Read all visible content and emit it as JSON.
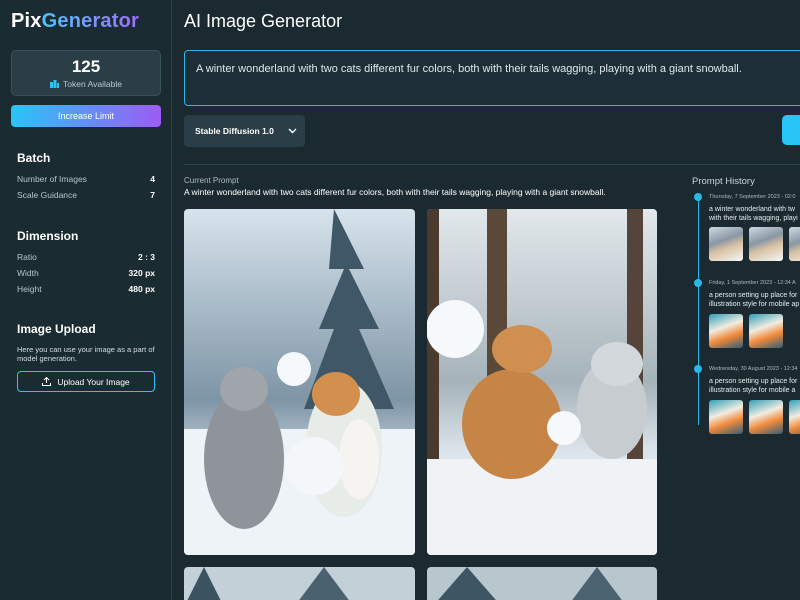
{
  "app": {
    "logo_part1": "Pix",
    "logo_part2": "Generator"
  },
  "tokens": {
    "count": "125",
    "label": "Token Available"
  },
  "increase_label": "Increase Limit",
  "batch": {
    "title": "Batch",
    "items": [
      {
        "label": "Number of Images",
        "value": "4"
      },
      {
        "label": "Scale Guidance",
        "value": "7"
      }
    ]
  },
  "dimension": {
    "title": "Dimension",
    "items": [
      {
        "label": "Ratio",
        "value": "2 : 3"
      },
      {
        "label": "Width",
        "value": "320 px"
      },
      {
        "label": "Height",
        "value": "480 px"
      }
    ]
  },
  "upload": {
    "title": "Image Upload",
    "description": "Here you can use your image as a part of model generation.",
    "button_label": "Upload Your Image"
  },
  "main": {
    "title": "AI Image Generator",
    "prompt_value": "A winter wonderland with two cats different fur colors, both with their tails wagging, playing with a giant snowball.",
    "model": "Stable Diffusion 1.0",
    "current_prompt_label": "Current Prompt",
    "current_prompt": "A winter wonderland with two cats different fur colors, both with their tails wagging, playing with a giant snowball."
  },
  "history": {
    "title": "Prompt History",
    "entries": [
      {
        "date": "Thursday, 7 September 2023 - 02:0",
        "line1": "a winter wonderland with tw",
        "line2": "with their tails wagging, playi"
      },
      {
        "date": "Friday, 1 September 2023 - 12:34 A",
        "line1": "a person setting up place for",
        "line2": "illustration style for mobile ap"
      },
      {
        "date": "Wednesday, 30 August 2023 - 12:34",
        "line1": "a person setting up place for",
        "line2": "illustration style for mobile a"
      }
    ]
  },
  "colors": {
    "accent": "#29c5f6",
    "accent_purple": "#9d5cf5",
    "background": "#1b2a31",
    "card": "#2b3e47"
  },
  "icons": {
    "token": "coins-icon",
    "upload": "upload-icon",
    "dropdown": "chevron-down-icon"
  }
}
